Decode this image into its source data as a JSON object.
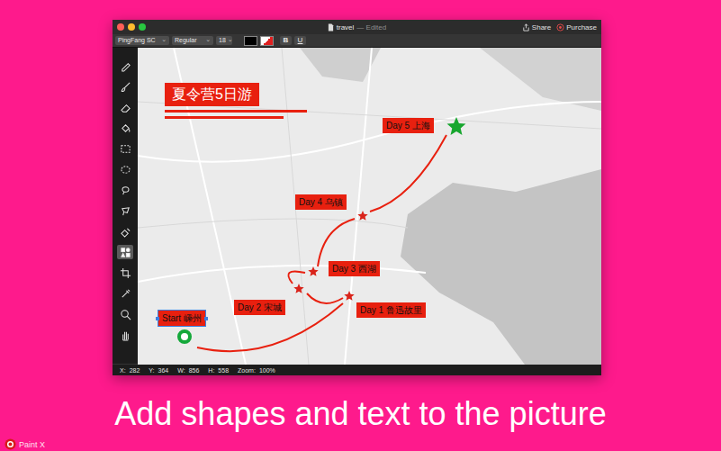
{
  "window": {
    "title": "travel",
    "edited": "— Edited"
  },
  "header_actions": [
    {
      "label": "Share"
    },
    {
      "label": "Purchase"
    }
  ],
  "toolbar": {
    "font": "PingFang SC",
    "style": "Regular",
    "size": "18",
    "bold": "B",
    "underline": "U"
  },
  "tools": [
    {
      "selected": false
    },
    {
      "selected": false
    },
    {
      "selected": false
    },
    {
      "selected": false
    },
    {
      "selected": false
    },
    {
      "selected": false
    },
    {
      "selected": false
    },
    {
      "selected": false
    },
    {
      "selected": false
    },
    {
      "selected": true
    },
    {
      "selected": false
    },
    {
      "selected": false
    },
    {
      "selected": false
    },
    {
      "selected": false
    }
  ],
  "canvas": {
    "title": "夏令营5日游",
    "stops": [
      {
        "label": "Start 嵊州",
        "kind": "circle",
        "color": "#14a83a",
        "selected": true
      },
      {
        "label": "Day 1 鲁迅故里",
        "kind": "star",
        "color": "#d9231a",
        "selected": false
      },
      {
        "label": "Day 2 宋城",
        "kind": "star",
        "color": "#d9231a",
        "selected": false
      },
      {
        "label": "Day 3 西湖",
        "kind": "star",
        "color": "#d9231a",
        "selected": false
      },
      {
        "label": "Day 4 乌镇",
        "kind": "star",
        "color": "#d9231a",
        "selected": false
      },
      {
        "label": "Day 5 上海",
        "kind": "star",
        "color": "#17a62e",
        "selected": false
      }
    ]
  },
  "status_bar": [
    {
      "label": "X:",
      "value": "282"
    },
    {
      "label": "Y:",
      "value": "364"
    },
    {
      "label": "W:",
      "value": "856"
    },
    {
      "label": "H:",
      "value": "558"
    },
    {
      "label": "Zoom:",
      "value": "100%"
    }
  ],
  "caption": "Add shapes and text to the picture",
  "logo": {
    "text": "Paint X"
  }
}
